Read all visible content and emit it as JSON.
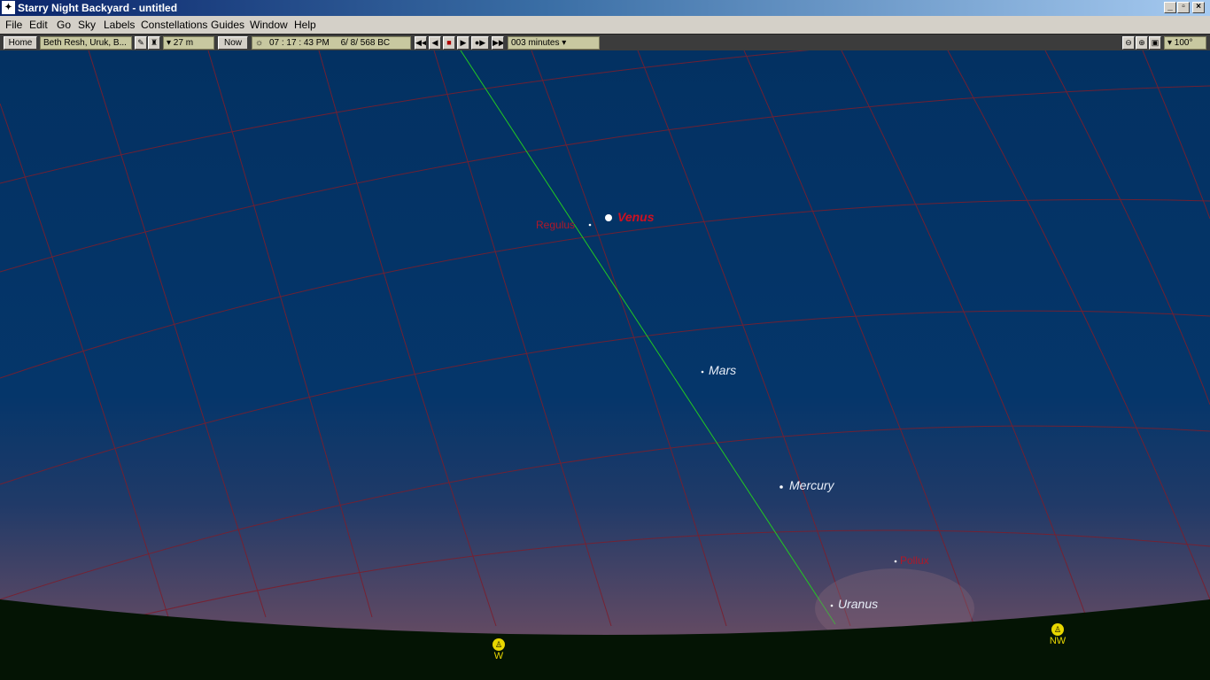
{
  "window": {
    "title": "Starry Night Backyard - untitled",
    "minimize": "_",
    "restore": "▫",
    "close": "×"
  },
  "menu": [
    "File",
    "Edit",
    "Go",
    "Sky",
    "Labels",
    "Constellations",
    "Guides",
    "Window",
    "Help"
  ],
  "toolbar": {
    "home": "Home",
    "location": "Beth Resh, Uruk, B...",
    "elevation": "▾ 27 m",
    "now": "Now",
    "time": "07 : 17 : 43  PM",
    "date": "6/  8/  568 BC",
    "step": "003 minutes ▾",
    "fov": "▾ 100°",
    "icons": [
      "pencil-icon",
      "telescope-icon",
      "rewind-icon",
      "step-back-icon",
      "stop-icon",
      "play-icon",
      "step-forward-icon",
      "fast-forward-icon",
      "zoom-out-icon",
      "zoom-in-icon",
      "fit-view-icon"
    ]
  },
  "sky": {
    "objects": [
      {
        "name": "Venus",
        "kind": "planet-major"
      },
      {
        "name": "Regulus",
        "kind": "star"
      },
      {
        "name": "Mars",
        "kind": "planet"
      },
      {
        "name": "Mercury",
        "kind": "planet"
      },
      {
        "name": "Uranus",
        "kind": "planet"
      },
      {
        "name": "Pollux",
        "kind": "star"
      }
    ],
    "compass": [
      {
        "label": "W"
      },
      {
        "label": "NW"
      }
    ],
    "colors": {
      "grid": "#7a1f2e",
      "ecliptic": "#22c822",
      "horizon": "#041404",
      "planet_label": "#e8eef8",
      "venus_label": "#d01020",
      "star_label": "#b01828"
    }
  }
}
